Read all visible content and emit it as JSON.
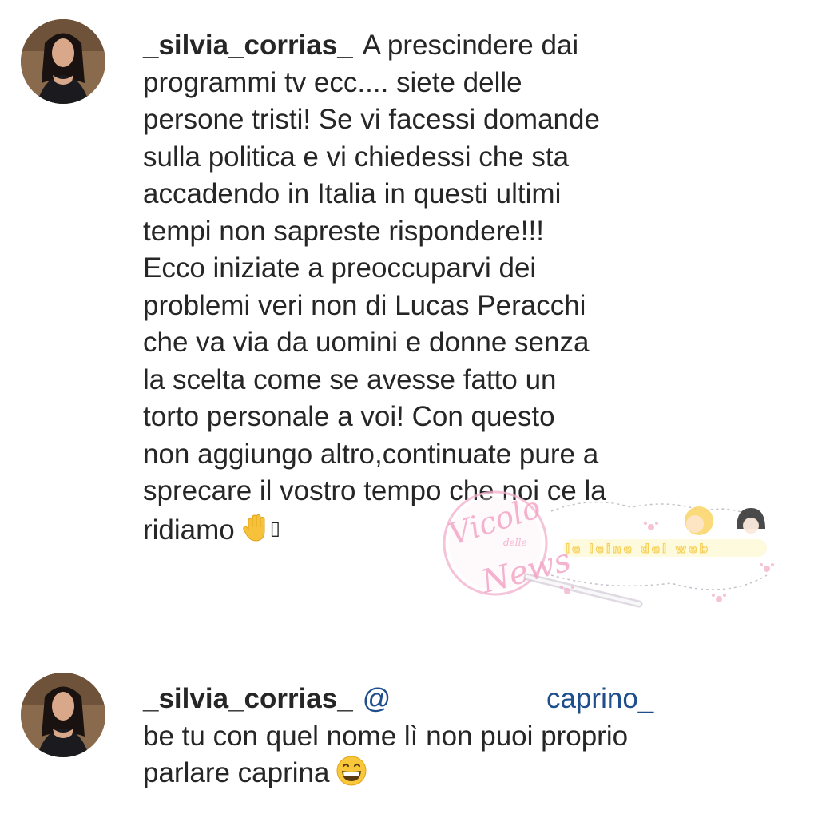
{
  "comments": [
    {
      "avatar_icon": "profile-photo-avatar",
      "username": "_silvia_corrias_",
      "lines": [
        "A prescindere dai",
        "programmi tv ecc.... siete delle",
        "persone tristi! Se vi facessi domande",
        "sulla politica e vi chiedessi che sta",
        "accadendo in Italia in questi ultimi",
        "tempi non sapreste rispondere!!!",
        "Ecco iniziate a preoccuparvi dei",
        "problemi veri non di Lucas Peracchi",
        "che va via da uomini e donne senza",
        "la scelta come se avesse fatto un",
        "torto personale a voi! Con questo",
        "non aggiungo altro,continuate pure a",
        "sprecare il vostro tempo che noi ce la",
        "ridiamo"
      ],
      "trailing_emoji": "raised-hand-emoji",
      "trailing_glyph": "▯"
    },
    {
      "avatar_icon": "profile-photo-avatar",
      "username": "_silvia_corrias_",
      "mention_at": "@",
      "mention_name": "caprino_",
      "lines": [
        "be tu con quel nome lì non puoi proprio",
        "parlare caprina"
      ],
      "trailing_emoji": "grinning-face-emoji"
    }
  ],
  "watermark": {
    "script_word_1": "Vicolo",
    "script_word_2": "delle",
    "script_word_3": "News",
    "banner": "le leine del web"
  },
  "colors": {
    "text": "#262626",
    "mention": "#1e4e8c",
    "watermark_pink": "#f3a6c6",
    "watermark_yellow": "#fff3a8"
  }
}
